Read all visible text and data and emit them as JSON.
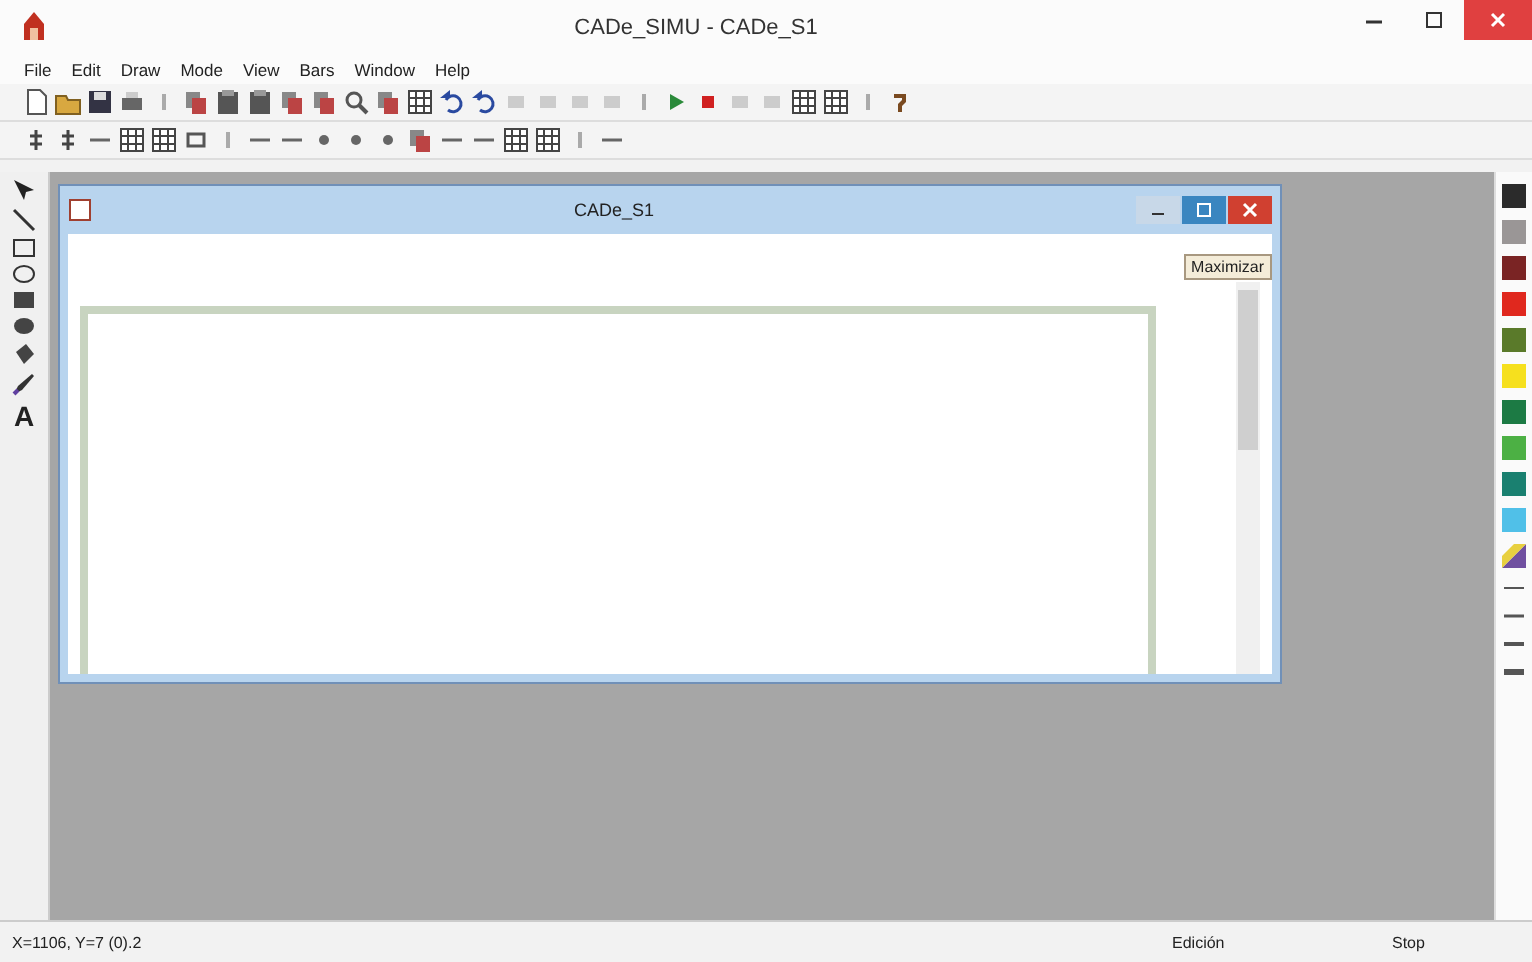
{
  "window": {
    "title": "CADe_SIMU - CADe_S1"
  },
  "menu": [
    {
      "label": "File"
    },
    {
      "label": "Edit"
    },
    {
      "label": "Draw"
    },
    {
      "label": "Mode"
    },
    {
      "label": "View"
    },
    {
      "label": "Bars"
    },
    {
      "label": "Window"
    },
    {
      "label": "Help"
    }
  ],
  "tools": {
    "text_tool": "A"
  },
  "child_window": {
    "title": "CADe_S1",
    "tooltip": "Maximizar"
  },
  "palette": [
    {
      "color": "#2b2b2b"
    },
    {
      "color": "#9a9696"
    },
    {
      "color": "#7a2424"
    },
    {
      "color": "#e0281e"
    },
    {
      "color": "#5a7a2a"
    },
    {
      "color": "#f6e01e"
    },
    {
      "color": "#1c7a44"
    },
    {
      "color": "#4cb044"
    },
    {
      "color": "#1a8070"
    },
    {
      "color": "#50c0e8"
    }
  ],
  "status_bar": {
    "coordinates": "X=1106, Y=7 (0).2",
    "mode": "Edición",
    "state": "Stop"
  }
}
